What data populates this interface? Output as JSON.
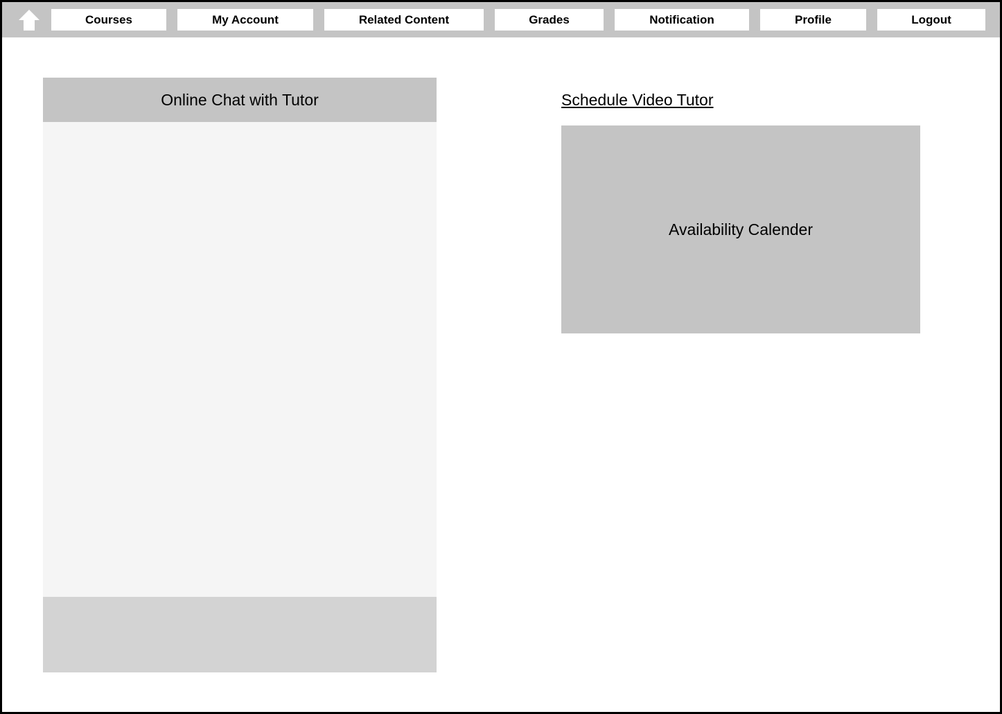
{
  "nav": {
    "home_icon": "home-icon",
    "items": [
      {
        "label": "Courses"
      },
      {
        "label": "My Account"
      },
      {
        "label": "Related Content"
      },
      {
        "label": "Grades"
      },
      {
        "label": "Notification"
      },
      {
        "label": "Profile"
      },
      {
        "label": "Logout"
      }
    ]
  },
  "chat": {
    "title": "Online Chat with Tutor"
  },
  "schedule": {
    "link_label": "Schedule Video Tutor",
    "calendar_label": "Availability Calender"
  },
  "colors": {
    "navbar_bg": "#c4c4c4",
    "panel_gray": "#c4c4c4",
    "chat_body_bg": "#f5f5f5",
    "chat_input_bg": "#d3d3d3"
  }
}
